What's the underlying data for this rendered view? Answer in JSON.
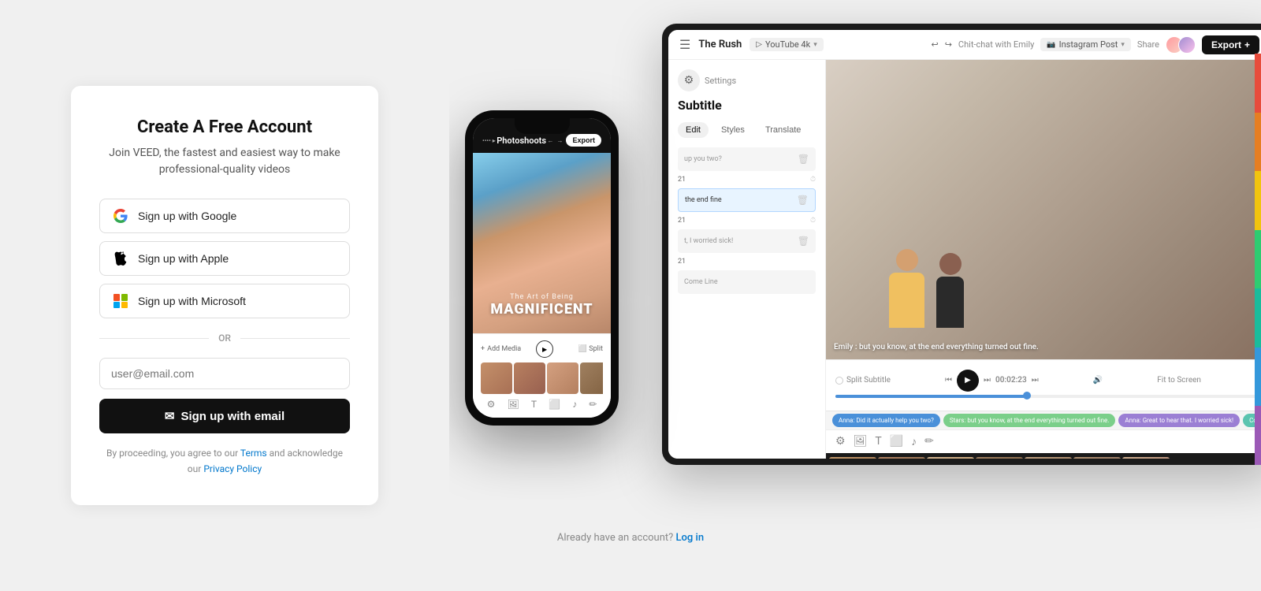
{
  "page": {
    "background_color": "#f0f0f0"
  },
  "signup_card": {
    "title": "Create A Free Account",
    "subtitle": "Join VEED, the fastest and easiest way to make professional-quality videos",
    "google_btn": "Sign up with Google",
    "apple_btn": "Sign up with Apple",
    "microsoft_btn": "Sign up with Microsoft",
    "divider_text": "OR",
    "email_placeholder": "user@email.com",
    "email_btn": "Sign up with email",
    "terms_prefix": "By proceeding, you agree to our ",
    "terms_link": "Terms",
    "terms_middle": " and acknowledge our ",
    "privacy_link": "Privacy Policy",
    "already_text": "Already have an account?",
    "login_link": "Log in"
  },
  "tablet": {
    "title": "The Rush",
    "format": "YouTube 4k",
    "panel_title": "Subtitle",
    "breadcrumb": "Chit-chat with Emily",
    "breadcrumb2": "Instagram Post",
    "share_label": "Share",
    "export_btn": "Export",
    "tabs": [
      "Edit",
      "Styles",
      "Translate"
    ],
    "active_tab": "Edit",
    "subtitle_lines": [
      "up you two?",
      "the end fine",
      "t, I worried sick!",
      "Come Line"
    ],
    "video_caption": "Emily : but you know, at the end everything turned out fine.",
    "time_display": "00:02:23",
    "fit_screen": "Fit to Screen",
    "subtitle_chips": [
      "Anna: Did it actually help you two?",
      "Stars: but you know, at the end everything turned out fine.",
      "Anna: Great to hear that. I worried sick!",
      "Come Line!"
    ]
  },
  "phone": {
    "header_title": "Photoshoots",
    "export_btn": "Export",
    "video_subtitle": "The Art of Being",
    "video_title": "MAGNIFICENT",
    "add_media": "Add Media",
    "split_label": "Split"
  },
  "color_palette": [
    "#e74c3c",
    "#e67e22",
    "#f1c40f",
    "#2ecc71",
    "#1abc9c",
    "#3498db",
    "#9b59b6"
  ]
}
